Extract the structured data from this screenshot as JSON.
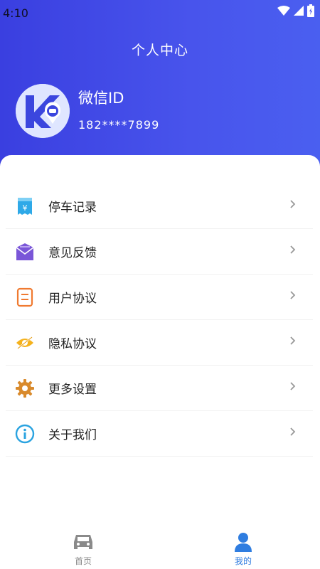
{
  "status_bar": {
    "time": "4:10"
  },
  "header": {
    "title": "个人中心"
  },
  "profile": {
    "name": "微信ID",
    "phone": "182****7899"
  },
  "menu": {
    "items": [
      {
        "label": "停车记录",
        "icon": "receipt-yen-icon"
      },
      {
        "label": "意见反馈",
        "icon": "envelope-icon"
      },
      {
        "label": "用户协议",
        "icon": "document-icon"
      },
      {
        "label": "隐私协议",
        "icon": "eye-hidden-icon"
      },
      {
        "label": "更多设置",
        "icon": "gear-icon"
      },
      {
        "label": "关于我们",
        "icon": "info-icon"
      }
    ]
  },
  "tabbar": {
    "items": [
      {
        "label": "首页",
        "icon": "car-icon",
        "active": false
      },
      {
        "label": "我的",
        "icon": "user-icon",
        "active": true
      }
    ]
  },
  "colors": {
    "header_start": "#3a3fe0",
    "header_end": "#4a5ff0",
    "tab_active": "#2f7de0",
    "tab_inactive": "#8a8a8a"
  }
}
